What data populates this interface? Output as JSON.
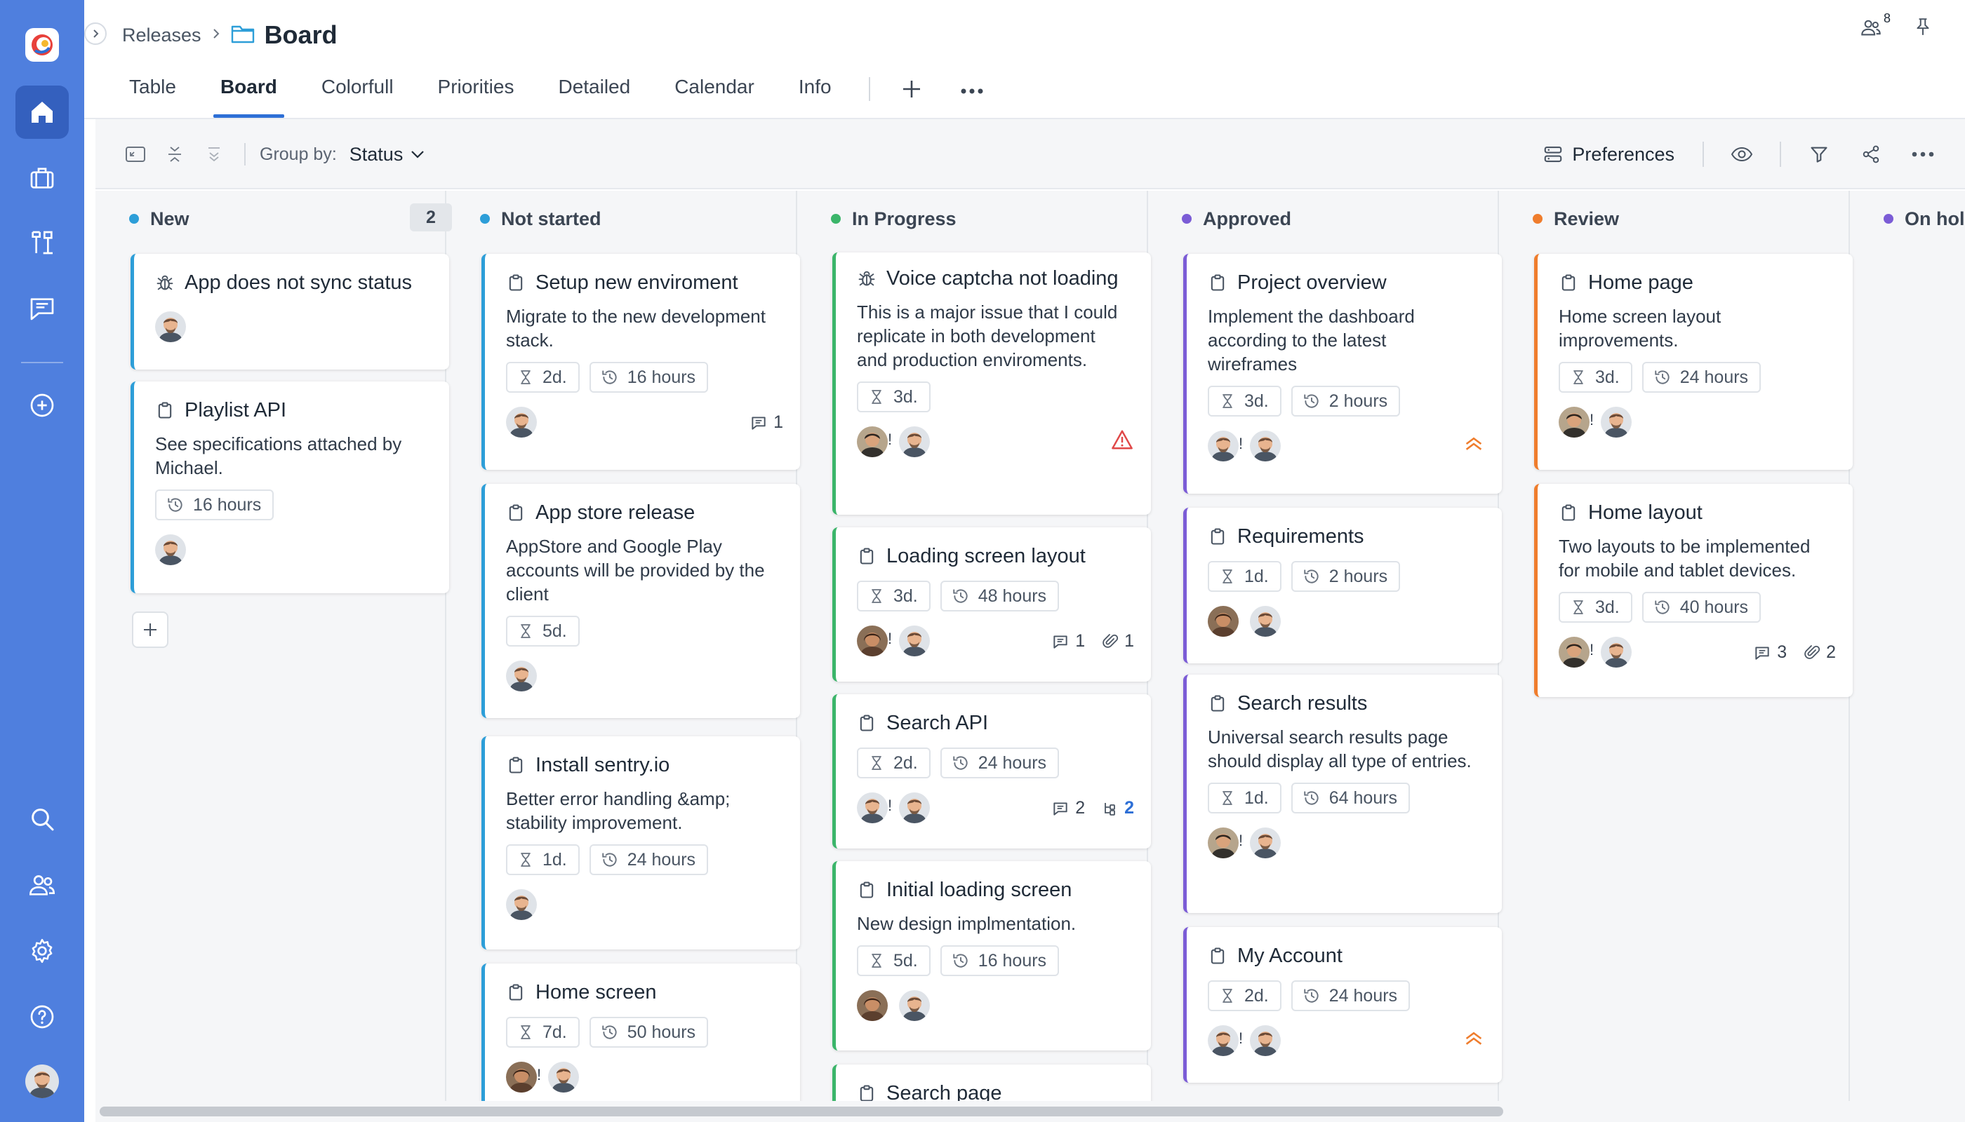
{
  "header": {
    "breadcrumb_parent": "Releases",
    "title": "Board",
    "followers_count": "8"
  },
  "tabs": [
    {
      "label": "Table",
      "active": false
    },
    {
      "label": "Board",
      "active": true
    },
    {
      "label": "Colorfull",
      "active": false
    },
    {
      "label": "Priorities",
      "active": false
    },
    {
      "label": "Detailed",
      "active": false
    },
    {
      "label": "Calendar",
      "active": false
    },
    {
      "label": "Info",
      "active": false
    }
  ],
  "toolbar": {
    "group_by_label": "Group by:",
    "group_by_value": "Status",
    "preferences_label": "Preferences"
  },
  "colors": {
    "rail": "#4f7fde",
    "accent": "#2d6fd6",
    "status_new": "#2d9ed8",
    "status_not_started": "#2d9ed8",
    "status_in_progress": "#3bb56a",
    "status_approved": "#7b5cd6",
    "status_review": "#ef7d2d",
    "status_on_hold": "#7b5cd6",
    "priority_high": "#ef7d2d",
    "warning": "#e04848"
  },
  "columns": [
    {
      "name": "New",
      "count": "2",
      "cards": [
        {
          "icon": "bug-icon",
          "title": "App does not sync status",
          "desc": "",
          "days": "",
          "hours": ""
        },
        {
          "icon": "clipboard-icon",
          "title": "Playlist API",
          "desc": "See specifications attached by Michael.",
          "days": "",
          "hours": "16 hours"
        }
      ]
    },
    {
      "name": "Not started",
      "cards": [
        {
          "icon": "clipboard-icon",
          "title": "Setup new enviroment",
          "desc": "Migrate to the new development stack.",
          "days": "2d.",
          "hours": "16 hours",
          "comments": "1"
        },
        {
          "icon": "clipboard-icon",
          "title": "App store release",
          "desc": "AppStore and Google Play accounts will be provided by the client",
          "days": "5d.",
          "hours": ""
        },
        {
          "icon": "clipboard-icon",
          "title": "Install sentry.io",
          "desc": "Better error handling &amp; stability improvement.",
          "days": "1d.",
          "hours": "24 hours"
        },
        {
          "icon": "clipboard-icon",
          "title": "Home screen",
          "desc": "",
          "days": "7d.",
          "hours": "50 hours"
        }
      ]
    },
    {
      "name": "In Progress",
      "cards": [
        {
          "icon": "bug-icon",
          "title": "Voice captcha not loading",
          "desc": "This is a major issue that I could replicate in both development and production enviroments.",
          "days": "3d.",
          "hours": ""
        },
        {
          "icon": "clipboard-icon",
          "title": "Loading screen layout",
          "desc": "",
          "days": "3d.",
          "hours": "48 hours",
          "comments": "1",
          "attachments": "1"
        },
        {
          "icon": "clipboard-icon",
          "title": "Search API",
          "desc": "",
          "days": "2d.",
          "hours": "24 hours",
          "comments": "2",
          "subtasks": "2"
        },
        {
          "icon": "clipboard-icon",
          "title": "Initial loading screen",
          "desc": "New design implmentation.",
          "days": "5d.",
          "hours": "16 hours"
        },
        {
          "icon": "clipboard-icon",
          "title": "Search page",
          "desc": "",
          "days": "",
          "hours": ""
        }
      ]
    },
    {
      "name": "Approved",
      "cards": [
        {
          "icon": "clipboard-icon",
          "title": "Project overview",
          "desc": "Implement the dashboard according to the latest wireframes",
          "days": "3d.",
          "hours": "2 hours"
        },
        {
          "icon": "clipboard-icon",
          "title": "Requirements",
          "desc": "",
          "days": "1d.",
          "hours": "2 hours"
        },
        {
          "icon": "clipboard-icon",
          "title": "Search results",
          "desc": "Universal search results page should display all type of entries.",
          "days": "1d.",
          "hours": "64 hours"
        },
        {
          "icon": "clipboard-icon",
          "title": "My Account",
          "desc": "",
          "days": "2d.",
          "hours": "24 hours"
        }
      ]
    },
    {
      "name": "Review",
      "cards": [
        {
          "icon": "clipboard-icon",
          "title": "Home page",
          "desc": "Home screen layout improvements.",
          "days": "3d.",
          "hours": "24 hours"
        },
        {
          "icon": "clipboard-icon",
          "title": "Home layout",
          "desc": "Two layouts to be implemented for mobile and tablet devices.",
          "days": "3d.",
          "hours": "40 hours",
          "comments": "3",
          "attachments": "2"
        }
      ]
    },
    {
      "name": "On hold",
      "cards": []
    }
  ]
}
